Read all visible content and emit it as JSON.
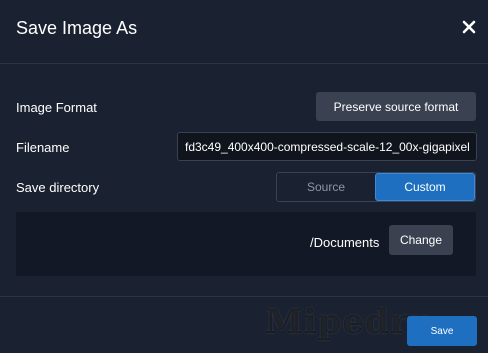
{
  "dialog": {
    "title": "Save Image As",
    "close_icon": "close-icon"
  },
  "image_format": {
    "label": "Image Format",
    "button_label": "Preserve source format"
  },
  "filename": {
    "label": "Filename",
    "value": "fd3c49_400x400-compressed-scale-12_00x-gigapixel"
  },
  "save_directory": {
    "label": "Save directory",
    "options": [
      "Source",
      "Custom"
    ],
    "selected": "Custom",
    "path": "/Documents",
    "change_label": "Change"
  },
  "footer": {
    "save_label": "Save"
  },
  "watermark": {
    "text": "Mipedru"
  },
  "colors": {
    "background": "#1a2130",
    "accent": "#1e6fc0",
    "button": "#3a4150"
  }
}
